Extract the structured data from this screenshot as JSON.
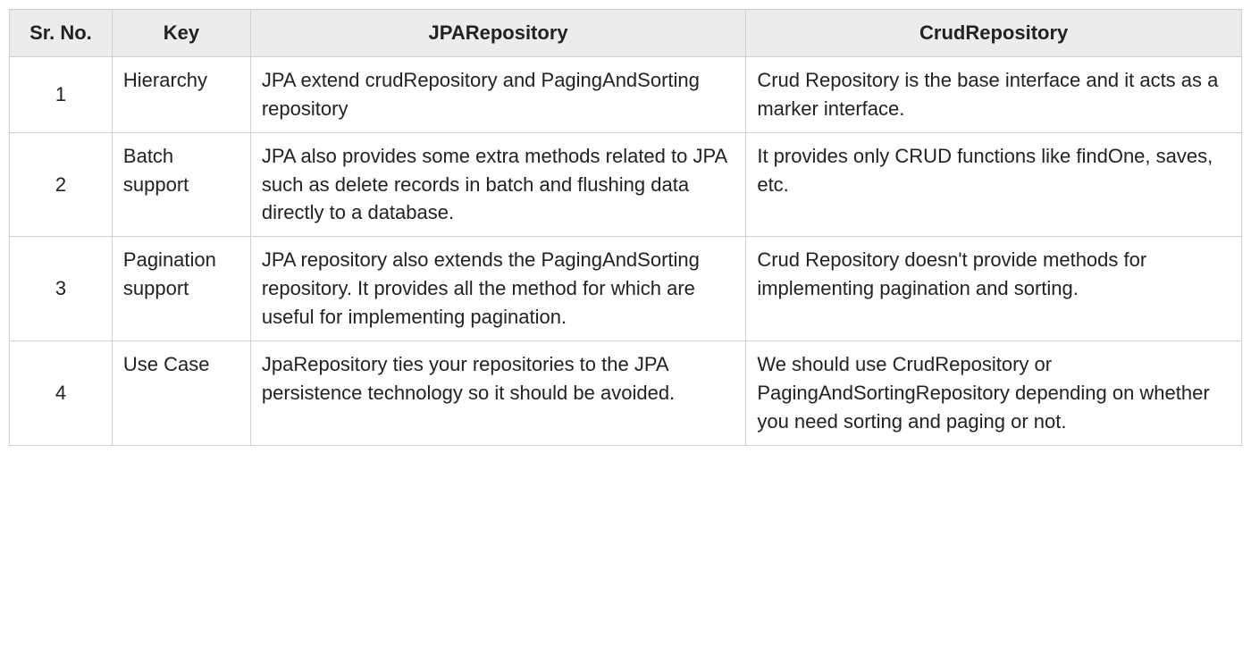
{
  "table": {
    "headers": {
      "srno": "Sr. No.",
      "key": "Key",
      "jpa": "JPARepository",
      "crud": "CrudRepository"
    },
    "rows": [
      {
        "srno": "1",
        "key": "Hierarchy",
        "jpa": "JPA extend crudRepository and PagingAndSorting repository",
        "crud": "Crud Repository is the base interface and it acts as a marker interface."
      },
      {
        "srno": "2",
        "key": "Batch support",
        "jpa": "JPA also provides some extra methods related to JPA such as delete records in batch and flushing data directly to a database.",
        "crud": "It provides only CRUD functions like findOne, saves, etc."
      },
      {
        "srno": "3",
        "key": "Pagination support",
        "jpa": "JPA repository also extends the PagingAndSorting repository. It provides all the method for which are useful for implementing pagination.",
        "crud": "Crud Repository doesn't provide methods for implementing pagination and sorting."
      },
      {
        "srno": "4",
        "key": "Use Case",
        "jpa": "JpaRepository ties your repositories to the JPA persistence technology so it should be avoided.",
        "crud": "We should use CrudRepository or PagingAndSortingRepository depending on whether you need sorting and paging or not."
      }
    ]
  }
}
